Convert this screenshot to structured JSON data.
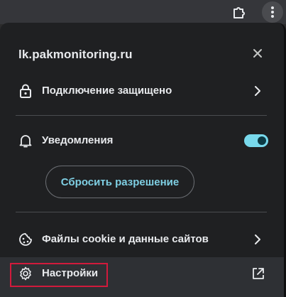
{
  "browser_toolbar": {
    "extensions_icon": "puzzle-icon",
    "menu_icon": "three-dots-vertical-icon"
  },
  "popup": {
    "site": "lk.pakmonitoring.ru",
    "close_icon": "close-icon",
    "connection": {
      "label": "Подключение защищено",
      "icon": "lock-icon",
      "chevron": "chevron-right-icon"
    },
    "notifications": {
      "label": "Уведомления",
      "icon": "bell-icon",
      "enabled": true,
      "reset_label": "Сбросить разрешение"
    },
    "cookies": {
      "label": "Файлы cookie и данные сайтов",
      "icon": "cookie-icon",
      "chevron": "chevron-right-icon"
    },
    "settings": {
      "label": "Настройки",
      "icon": "gear-icon",
      "external_icon": "open-in-new-icon",
      "highlighted": true
    }
  },
  "colors": {
    "background": "#1f2022",
    "text": "#e8eaed",
    "accent": "#78d9ec",
    "link": "#7fcfe3",
    "highlight_border": "#d11a3c"
  }
}
